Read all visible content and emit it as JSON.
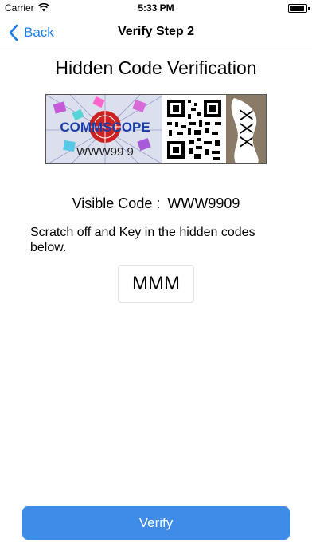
{
  "status_bar": {
    "carrier": "Carrier",
    "time": "5:33 PM",
    "wifi_icon": "wifi-icon",
    "battery_icon": "battery-icon"
  },
  "nav": {
    "back_label": "Back",
    "back_icon": "chevron-left-icon",
    "title": "Verify Step 2",
    "accent_color": "#1a7fe8"
  },
  "page_title": "Hidden Code Verification",
  "label_image": {
    "logo_text": "COMMSCOPE",
    "serial_text": "WWW99 9",
    "qr_icon": "qr-code-icon",
    "hidden_text": "XXX"
  },
  "visible_code": {
    "label": "Visible Code :",
    "value": "WWW9909"
  },
  "instruction": "Scratch off and Key in the hidden codes below.",
  "code_input": {
    "value": "MMM"
  },
  "verify_button": {
    "label": "Verify",
    "color": "#3e8be8"
  }
}
